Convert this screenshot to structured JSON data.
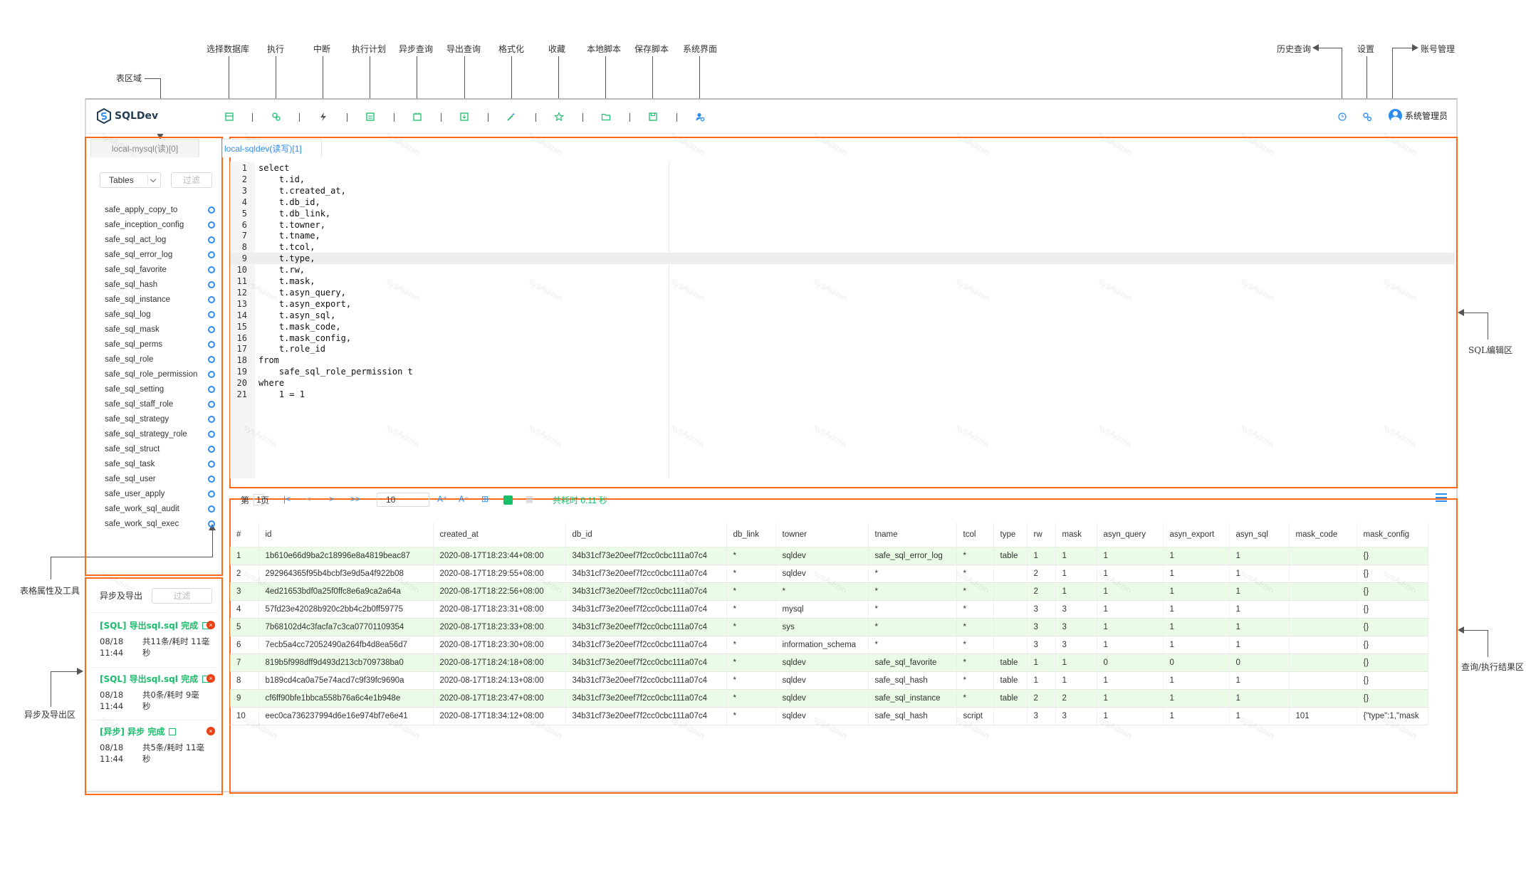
{
  "annotations": {
    "table_area": "表区域",
    "select_db": "选择数据库",
    "execute": "执行",
    "interrupt": "中断",
    "exec_plan": "执行计划",
    "async_query": "异步查询",
    "export_query": "导出查询",
    "format": "格式化",
    "favorite": "收藏",
    "local_script": "本地脚本",
    "save_script": "保存脚本",
    "system_ui": "系统界面",
    "history": "历史查询",
    "settings": "设置",
    "account": "账号管理",
    "sql_editor_area": "SQL编辑区",
    "table_props": "表格属性及工具",
    "async_export_area": "异步及导出区",
    "query_result_area": "查询/执行结果区"
  },
  "app": {
    "logo_text": "SQLDev",
    "user_name": "系统管理员"
  },
  "left_panel": {
    "tab_label": "local-mysql(读)[0]",
    "object_type": "Tables",
    "filter_placeholder": "过滤",
    "tables": [
      "safe_apply_copy_to",
      "safe_inception_config",
      "safe_sql_act_log",
      "safe_sql_error_log",
      "safe_sql_favorite",
      "safe_sql_hash",
      "safe_sql_instance",
      "safe_sql_log",
      "safe_sql_mask",
      "safe_sql_perms",
      "safe_sql_role",
      "safe_sql_role_permission",
      "safe_sql_setting",
      "safe_sql_staff_role",
      "safe_sql_strategy",
      "safe_sql_strategy_role",
      "safe_sql_struct",
      "safe_sql_task",
      "safe_sql_user",
      "safe_user_apply",
      "safe_work_sql_audit",
      "safe_work_sql_exec"
    ]
  },
  "async_panel": {
    "title": "异步及导出",
    "filter_placeholder": "过滤",
    "tasks": [
      {
        "title": "[SQL] 导出sql.sql 完成",
        "date": "08/18",
        "time": "11:44",
        "summary_line1": "共11条/耗时 11毫",
        "summary_line2": "秒"
      },
      {
        "title": "[SQL] 导出sql.sql 完成",
        "date": "08/18",
        "time": "11:44",
        "summary_line1": "共0条/耗时 9毫",
        "summary_line2": "秒"
      },
      {
        "title": "[异步] 异步 完成",
        "date": "08/18",
        "time": "11:44",
        "summary_line1": "共5条/耗时 11毫",
        "summary_line2": "秒"
      }
    ]
  },
  "editor": {
    "tab_label": "local-sqldev(读写)[1]",
    "lines": [
      {
        "n": "1",
        "text": "select",
        "kw": true
      },
      {
        "n": "2",
        "text": "    t.id,"
      },
      {
        "n": "3",
        "text": "    t.created_at,"
      },
      {
        "n": "4",
        "text": "    t.db_id,"
      },
      {
        "n": "5",
        "text": "    t.db_link,"
      },
      {
        "n": "6",
        "text": "    t.towner,"
      },
      {
        "n": "7",
        "text": "    t.tname,"
      },
      {
        "n": "8",
        "text": "    t.tcol,"
      },
      {
        "n": "9",
        "text": "    t.type,"
      },
      {
        "n": "10",
        "text": "    t.rw,"
      },
      {
        "n": "11",
        "text": "    t.mask,"
      },
      {
        "n": "12",
        "text": "    t.asyn_query,"
      },
      {
        "n": "13",
        "text": "    t.asyn_export,"
      },
      {
        "n": "14",
        "text": "    t.asyn_sql,"
      },
      {
        "n": "15",
        "text": "    t.mask_code,"
      },
      {
        "n": "16",
        "text": "    t.mask_config,"
      },
      {
        "n": "17",
        "text": "    t.role_id"
      },
      {
        "n": "18",
        "text": "from",
        "kw": true
      },
      {
        "n": "19",
        "text": "    safe_sql_role_permission t"
      },
      {
        "n": "20",
        "text": "where",
        "kw": true
      },
      {
        "n": "21",
        "text": "    1 = 1",
        "num": true
      }
    ]
  },
  "results": {
    "page_prefix": "第",
    "page_number": "1",
    "page_suffix": "页",
    "page_size": "10",
    "elapsed": "共耗时 0.11 秒",
    "columns": [
      "#",
      "id",
      "created_at",
      "db_id",
      "db_link",
      "towner",
      "tname",
      "tcol",
      "type",
      "rw",
      "mask",
      "asyn_query",
      "asyn_export",
      "asyn_sql",
      "mask_code",
      "mask_config"
    ],
    "rows": [
      [
        "1",
        "1b610e66d9ba2c18996e8a4819beac87",
        "2020-08-17T18:23:44+08:00",
        "34b31cf73e20eef7f2cc0cbc111a07c4",
        "*",
        "sqldev",
        "safe_sql_error_log",
        "*",
        "table",
        "1",
        "1",
        "1",
        "1",
        "1",
        "",
        "{}"
      ],
      [
        "2",
        "292964365f95b4bcbf3e9d5a4f922b08",
        "2020-08-17T18:29:55+08:00",
        "34b31cf73e20eef7f2cc0cbc111a07c4",
        "*",
        "sqldev",
        "*",
        "*",
        "",
        "2",
        "1",
        "1",
        "1",
        "1",
        "",
        "{}"
      ],
      [
        "3",
        "4ed21653bdf0a25f0ffc8e6a9ca2a64a",
        "2020-08-17T18:22:56+08:00",
        "34b31cf73e20eef7f2cc0cbc111a07c4",
        "*",
        "*",
        "*",
        "*",
        "",
        "2",
        "1",
        "1",
        "1",
        "1",
        "",
        "{}"
      ],
      [
        "4",
        "57fd23e42028b920c2bb4c2b0ff59775",
        "2020-08-17T18:23:31+08:00",
        "34b31cf73e20eef7f2cc0cbc111a07c4",
        "*",
        "mysql",
        "*",
        "*",
        "",
        "3",
        "3",
        "1",
        "1",
        "1",
        "",
        "{}"
      ],
      [
        "5",
        "7b68102d4c3facfa7c3ca07701109354",
        "2020-08-17T18:23:33+08:00",
        "34b31cf73e20eef7f2cc0cbc111a07c4",
        "*",
        "sys",
        "*",
        "*",
        "",
        "3",
        "3",
        "1",
        "1",
        "1",
        "",
        "{}"
      ],
      [
        "6",
        "7ecb5a4cc72052490a264fb4d8ea56d7",
        "2020-08-17T18:23:30+08:00",
        "34b31cf73e20eef7f2cc0cbc111a07c4",
        "*",
        "information_schema",
        "*",
        "*",
        "",
        "3",
        "3",
        "1",
        "1",
        "1",
        "",
        "{}"
      ],
      [
        "7",
        "819b5f998dff9d493d213cb709738ba0",
        "2020-08-17T18:24:18+08:00",
        "34b31cf73e20eef7f2cc0cbc111a07c4",
        "*",
        "sqldev",
        "safe_sql_favorite",
        "*",
        "table",
        "1",
        "1",
        "0",
        "0",
        "0",
        "",
        "{}"
      ],
      [
        "8",
        "b189cd4ca0a75e74acd7c9f39fc9690a",
        "2020-08-17T18:24:13+08:00",
        "34b31cf73e20eef7f2cc0cbc111a07c4",
        "*",
        "sqldev",
        "safe_sql_hash",
        "*",
        "table",
        "1",
        "1",
        "1",
        "1",
        "1",
        "",
        "{}"
      ],
      [
        "9",
        "cf6ff90bfe1bbca558b76a6c4e1b948e",
        "2020-08-17T18:23:47+08:00",
        "34b31cf73e20eef7f2cc0cbc111a07c4",
        "*",
        "sqldev",
        "safe_sql_instance",
        "*",
        "table",
        "2",
        "2",
        "1",
        "1",
        "1",
        "",
        "{}"
      ],
      [
        "10",
        "eec0ca736237994d6e16e974bf7e6e41",
        "2020-08-17T18:34:12+08:00",
        "34b31cf73e20eef7f2cc0cbc111a07c4",
        "*",
        "sqldev",
        "safe_sql_hash",
        "script",
        "",
        "3",
        "3",
        "1",
        "1",
        "1",
        "101",
        "{\"type\":1,\"mask"
      ]
    ],
    "highlighted_rows": [
      1,
      3,
      5,
      7,
      9
    ]
  },
  "watermark": "sysAdmin",
  "colors": {
    "accent": "#2d8cf0",
    "region_border": "#ff6a1a",
    "success": "#19be6b",
    "row_highlight": "#eafbe6"
  }
}
